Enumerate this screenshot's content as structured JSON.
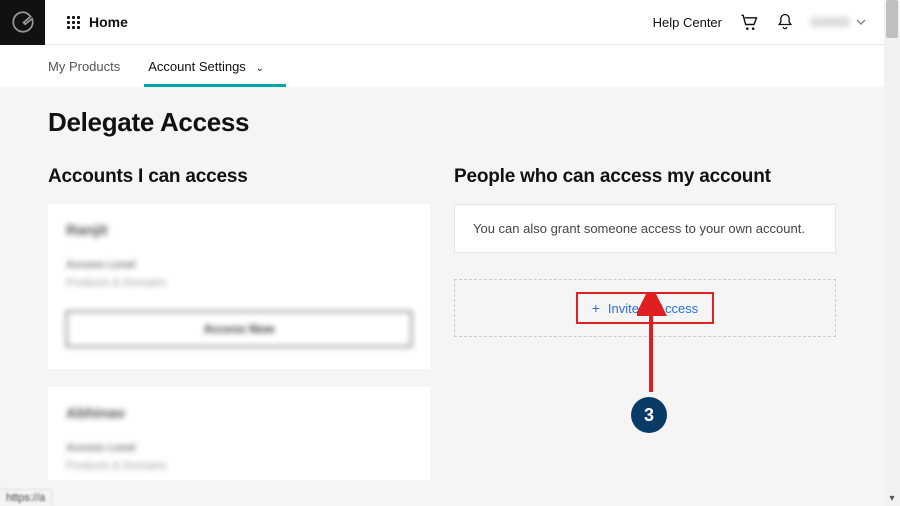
{
  "topbar": {
    "home_label": "Home",
    "help_label": "Help Center"
  },
  "subnav": {
    "my_products": "My Products",
    "account_settings": "Account Settings"
  },
  "page": {
    "title": "Delegate Access"
  },
  "left": {
    "heading": "Accounts I can access",
    "cards": [
      {
        "name": "Ranjit",
        "label": "Access Level",
        "sub": "Products & Domains",
        "button": "Access Now"
      },
      {
        "name": "Abhinav",
        "label": "Access Level",
        "sub": "Products & Domains"
      }
    ]
  },
  "right": {
    "heading": "People who can access my account",
    "info": "You can also grant someone access to your own account.",
    "invite_label": "Invite to Access"
  },
  "annotation": {
    "step": "3"
  },
  "status_url": "https://a"
}
